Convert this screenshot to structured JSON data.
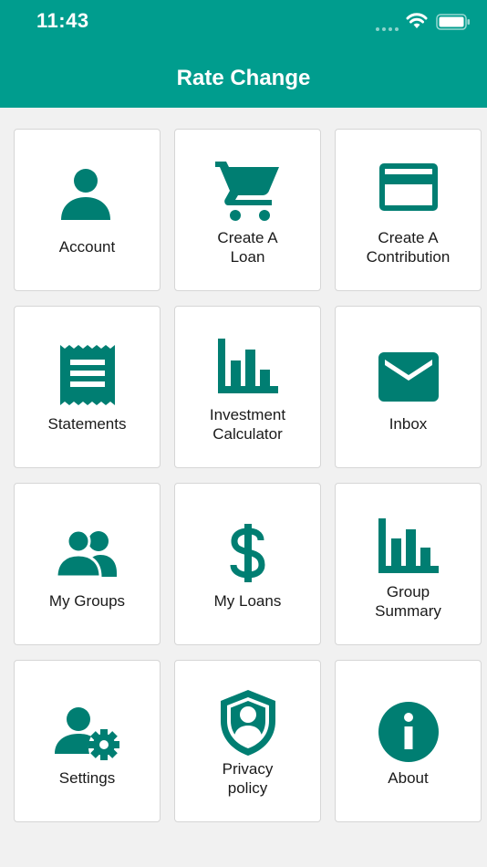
{
  "status_bar": {
    "time": "11:43"
  },
  "header": {
    "title": "Rate Change"
  },
  "colors": {
    "primary": "#009d8e",
    "icon": "#007e72",
    "background": "#f1f1f1"
  },
  "tiles": [
    {
      "label": "Account",
      "icon": "person-icon"
    },
    {
      "label": "Create A\nLoan",
      "icon": "cart-icon"
    },
    {
      "label": "Create A\nContribution",
      "icon": "credit-card-icon"
    },
    {
      "label": "Statements",
      "icon": "receipt-icon"
    },
    {
      "label": "Investment\nCalculator",
      "icon": "bar-chart-icon"
    },
    {
      "label": "Inbox",
      "icon": "mail-icon"
    },
    {
      "label": "My Groups",
      "icon": "people-icon"
    },
    {
      "label": "My Loans",
      "icon": "dollar-icon"
    },
    {
      "label": "Group\nSummary",
      "icon": "bar-chart-icon"
    },
    {
      "label": "Settings",
      "icon": "user-settings-icon"
    },
    {
      "label": "Privacy\npolicy",
      "icon": "shield-user-icon"
    },
    {
      "label": "About",
      "icon": "info-icon"
    }
  ]
}
